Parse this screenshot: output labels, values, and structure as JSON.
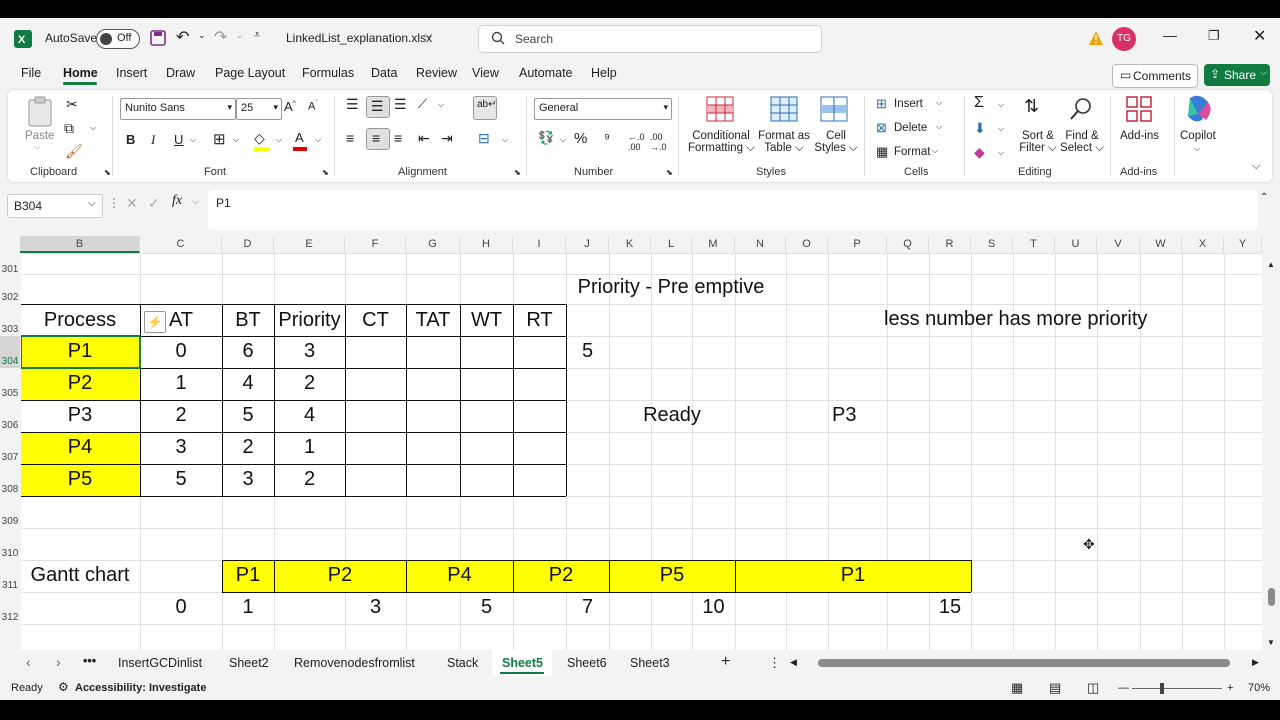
{
  "titlebar": {
    "autosave_label": "AutoSave",
    "autosave_state": "Off",
    "filename": "LinkedList_explanation.xlsx",
    "search_placeholder": "Search",
    "avatar_initials": "TG"
  },
  "menu": {
    "items": [
      "File",
      "Home",
      "Insert",
      "Draw",
      "Page Layout",
      "Formulas",
      "Data",
      "Review",
      "View",
      "Automate",
      "Help"
    ],
    "active": "Home",
    "comments_label": "Comments",
    "share_label": "Share"
  },
  "ribbon": {
    "clipboard": {
      "paste": "Paste",
      "label": "Clipboard"
    },
    "font": {
      "name": "Nunito Sans",
      "size": "25",
      "label": "Font",
      "bold": "B",
      "italic": "I",
      "underline": "U"
    },
    "alignment": {
      "label": "Alignment"
    },
    "number": {
      "format": "General",
      "label": "Number"
    },
    "styles": {
      "conditional": [
        "Conditional",
        "Formatting"
      ],
      "format_table": [
        "Format as",
        "Table"
      ],
      "cell_styles": [
        "Cell",
        "Styles"
      ],
      "label": "Styles"
    },
    "cells": {
      "insert": "Insert",
      "delete": "Delete",
      "format": "Format",
      "label": "Cells"
    },
    "editing": {
      "sort": [
        "Sort &",
        "Filter"
      ],
      "find": [
        "Find &",
        "Select"
      ],
      "label": "Editing"
    },
    "addins": {
      "button": "Add-ins",
      "label": "Add-ins"
    },
    "copilot": {
      "button": "Copilot"
    }
  },
  "formula_bar": {
    "name_box": "B304",
    "content": "P1"
  },
  "columns": [
    "B",
    "C",
    "D",
    "E",
    "F",
    "G",
    "H",
    "I",
    "J",
    "K",
    "L",
    "M",
    "N",
    "O",
    "P",
    "Q",
    "R",
    "S",
    "T",
    "U",
    "V",
    "W",
    "X",
    "Y"
  ],
  "rows": [
    "301",
    "302",
    "303",
    "304",
    "305",
    "306",
    "307",
    "308",
    "309",
    "310",
    "311",
    "312"
  ],
  "sheet": {
    "title": "Priority - Pre emptive",
    "note": "less number has more priority",
    "headers": [
      "Process",
      "AT",
      "BT",
      "Priority",
      "CT",
      "TAT",
      "WT",
      "RT"
    ],
    "processes": [
      {
        "name": "P1",
        "at": "0",
        "bt": "6",
        "priority": "3"
      },
      {
        "name": "P2",
        "at": "1",
        "bt": "4",
        "priority": "2"
      },
      {
        "name": "P3",
        "at": "2",
        "bt": "5",
        "priority": "4"
      },
      {
        "name": "P4",
        "at": "3",
        "bt": "2",
        "priority": "1"
      },
      {
        "name": "P5",
        "at": "5",
        "bt": "3",
        "priority": "2"
      }
    ],
    "j304": "5",
    "ready_label": "Ready",
    "ready_value": "P3",
    "gantt_label": "Gantt chart",
    "gantt_blocks": [
      "P1",
      "P2",
      "P4",
      "P2",
      "P5",
      "P1"
    ],
    "gantt_times": [
      "0",
      "1",
      "3",
      "5",
      "7",
      "10",
      "15"
    ],
    "highlight_color": "#ffff00"
  },
  "tabs": {
    "items": [
      "InsertGCDinlist",
      "Sheet2",
      "Removenodesfromlist",
      "Stack",
      "Sheet5",
      "Sheet6",
      "Sheet3"
    ],
    "active": "Sheet5",
    "more": "•••",
    "add": "+"
  },
  "status": {
    "ready": "Ready",
    "accessibility": "Accessibility: Investigate",
    "zoom": "70%"
  }
}
